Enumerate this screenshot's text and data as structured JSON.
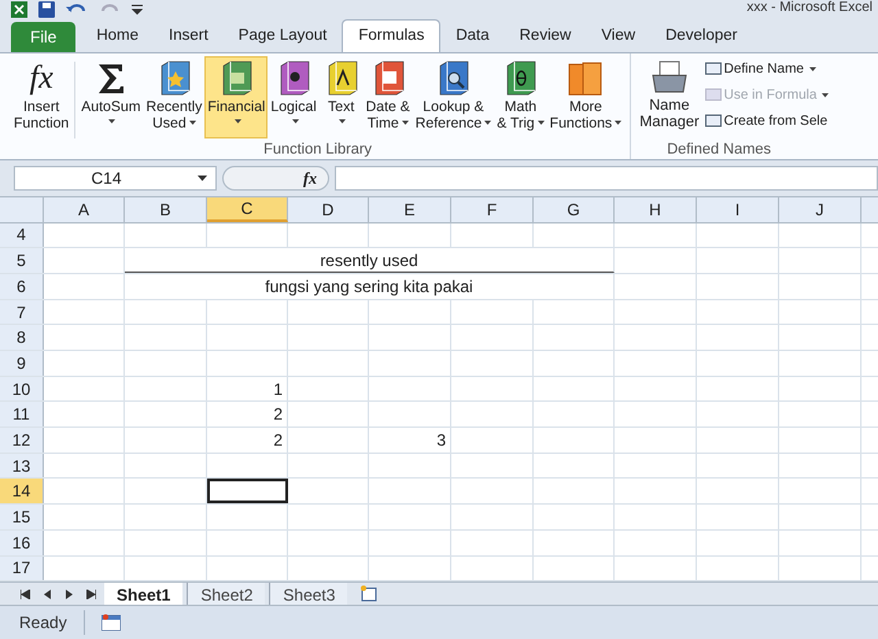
{
  "window": {
    "title": "xxx  -  Microsoft Excel"
  },
  "ribbon_tabs": [
    {
      "label": "File",
      "kind": "file",
      "selected": false
    },
    {
      "label": "Home",
      "kind": "tab",
      "selected": false
    },
    {
      "label": "Insert",
      "kind": "tab",
      "selected": false
    },
    {
      "label": "Page Layout",
      "kind": "tab",
      "selected": false
    },
    {
      "label": "Formulas",
      "kind": "tab",
      "selected": true
    },
    {
      "label": "Data",
      "kind": "tab",
      "selected": false
    },
    {
      "label": "Review",
      "kind": "tab",
      "selected": false
    },
    {
      "label": "View",
      "kind": "tab",
      "selected": false
    },
    {
      "label": "Developer",
      "kind": "tab",
      "selected": false
    }
  ],
  "function_library": {
    "label": "Function Library",
    "buttons": [
      {
        "lines": [
          "Insert",
          "Function"
        ],
        "icon_text": "fx",
        "dropdown": false,
        "highlighted": false
      },
      {
        "lines": [
          "AutoSum"
        ],
        "dropdown": true,
        "highlighted": false
      },
      {
        "lines": [
          "Recently",
          "Used"
        ],
        "dropdown": true,
        "highlighted": false
      },
      {
        "lines": [
          "Financial"
        ],
        "dropdown": true,
        "highlighted": true
      },
      {
        "lines": [
          "Logical"
        ],
        "dropdown": true,
        "highlighted": false
      },
      {
        "lines": [
          "Text"
        ],
        "dropdown": true,
        "highlighted": false
      },
      {
        "lines": [
          "Date &",
          "Time"
        ],
        "dropdown": true,
        "highlighted": false
      },
      {
        "lines": [
          "Lookup &",
          "Reference"
        ],
        "dropdown": true,
        "highlighted": false
      },
      {
        "lines": [
          "Math",
          "& Trig"
        ],
        "dropdown": true,
        "highlighted": false
      },
      {
        "lines": [
          "More",
          "Functions"
        ],
        "dropdown": true,
        "highlighted": false
      }
    ]
  },
  "defined_names": {
    "label": "Defined Names",
    "manager": {
      "lines": [
        "Name",
        "Manager"
      ]
    },
    "items": [
      {
        "label": "Define Name",
        "dropdown": true,
        "disabled": false
      },
      {
        "label": "Use in Formula",
        "dropdown": true,
        "disabled": true
      },
      {
        "label": "Create from Sele",
        "dropdown": false,
        "disabled": false
      }
    ]
  },
  "name_box": {
    "value": "C14"
  },
  "formula_bar": {
    "insert_function": "fx"
  },
  "columns": [
    {
      "label": "A",
      "selected": false
    },
    {
      "label": "B",
      "selected": false
    },
    {
      "label": "C",
      "selected": true
    },
    {
      "label": "D",
      "selected": false
    },
    {
      "label": "E",
      "selected": false
    },
    {
      "label": "F",
      "selected": false
    },
    {
      "label": "G",
      "selected": false
    },
    {
      "label": "H",
      "selected": false
    },
    {
      "label": "I",
      "selected": false
    },
    {
      "label": "J",
      "selected": false
    }
  ],
  "rows": [
    {
      "label": "4",
      "selected": false,
      "cells": {}
    },
    {
      "label": "5",
      "selected": false,
      "cells": {
        "B": {
          "text": "resently used",
          "merged": true,
          "bottom_border": true
        }
      }
    },
    {
      "label": "6",
      "selected": false,
      "cells": {
        "B": {
          "text": "fungsi yang sering kita pakai",
          "merged": true,
          "bottom_border": false
        }
      }
    },
    {
      "label": "7",
      "selected": false,
      "cells": {}
    },
    {
      "label": "8",
      "selected": false,
      "cells": {}
    },
    {
      "label": "9",
      "selected": false,
      "cells": {}
    },
    {
      "label": "10",
      "selected": false,
      "cells": {
        "C": {
          "text": "1",
          "merged": false,
          "bottom_border": false
        }
      }
    },
    {
      "label": "11",
      "selected": false,
      "cells": {
        "C": {
          "text": "2",
          "merged": false,
          "bottom_border": false
        }
      }
    },
    {
      "label": "12",
      "selected": false,
      "cells": {
        "C": {
          "text": "2",
          "merged": false,
          "bottom_border": false
        },
        "E": {
          "text": "3",
          "merged": false,
          "bottom_border": false
        }
      }
    },
    {
      "label": "13",
      "selected": false,
      "cells": {}
    },
    {
      "label": "14",
      "selected": true,
      "cells": {}
    },
    {
      "label": "15",
      "selected": false,
      "cells": {}
    },
    {
      "label": "16",
      "selected": false,
      "cells": {}
    },
    {
      "label": "17",
      "selected": false,
      "cells": {}
    }
  ],
  "sheet_tabs": [
    {
      "label": "Sheet1",
      "selected": true
    },
    {
      "label": "Sheet2",
      "selected": false
    },
    {
      "label": "Sheet3",
      "selected": false
    }
  ],
  "status_bar": {
    "text": "Ready"
  }
}
